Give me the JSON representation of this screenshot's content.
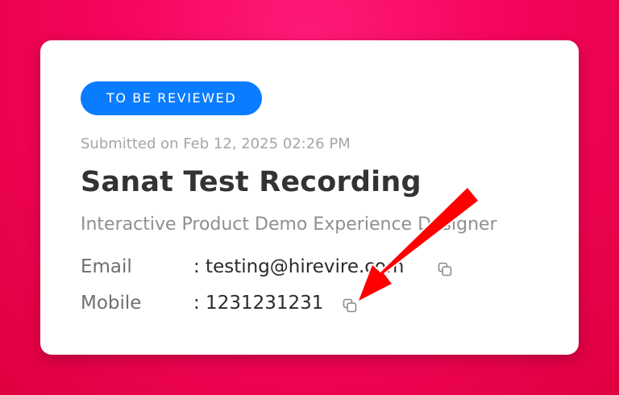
{
  "card": {
    "status_badge": "TO BE REVIEWED",
    "submitted": "Submitted on Feb 12, 2025 02:26 PM",
    "title": "Sanat Test Recording",
    "subtitle": "Interactive Product Demo Experience Designer",
    "fields": [
      {
        "label": "Email",
        "value": ": testing@hirevire.com",
        "icon": "copy-icon"
      },
      {
        "label": "Mobile",
        "value": ": 1231231231",
        "icon": "copy-icon"
      }
    ]
  },
  "colors": {
    "background_accent": "#f5055e",
    "badge": "#0a7cff",
    "annotation_arrow": "#ff0000"
  }
}
